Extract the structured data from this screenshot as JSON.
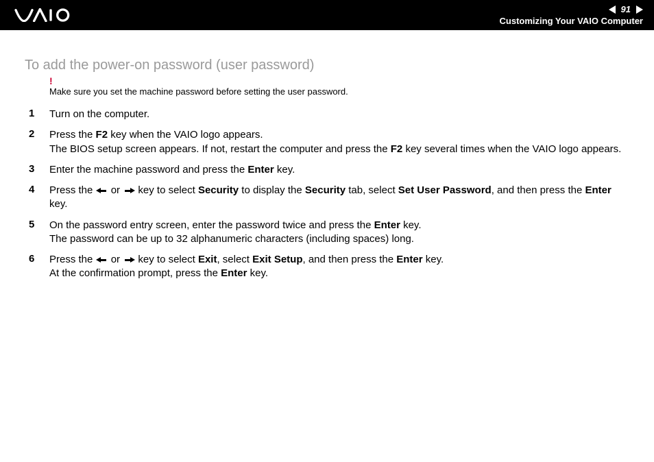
{
  "header": {
    "page_number": "91",
    "section_title": "Customizing Your VAIO Computer"
  },
  "heading": "To add the power-on password (user password)",
  "warning": {
    "icon": "!",
    "text": "Make sure you set the machine password before setting the user password."
  },
  "steps": [
    {
      "num": "1",
      "parts": [
        {
          "t": "text",
          "v": "Turn on the computer."
        }
      ]
    },
    {
      "num": "2",
      "parts": [
        {
          "t": "text",
          "v": "Press the "
        },
        {
          "t": "bold",
          "v": "F2"
        },
        {
          "t": "text",
          "v": " key when the VAIO logo appears."
        },
        {
          "t": "br"
        },
        {
          "t": "text",
          "v": "The BIOS setup screen appears. If not, restart the computer and press the "
        },
        {
          "t": "bold",
          "v": "F2"
        },
        {
          "t": "text",
          "v": " key several times when the VAIO logo appears."
        }
      ]
    },
    {
      "num": "3",
      "parts": [
        {
          "t": "text",
          "v": "Enter the machine password and press the "
        },
        {
          "t": "bold",
          "v": "Enter"
        },
        {
          "t": "text",
          "v": " key."
        }
      ]
    },
    {
      "num": "4",
      "parts": [
        {
          "t": "text",
          "v": "Press the "
        },
        {
          "t": "arrow-left"
        },
        {
          "t": "text",
          "v": " or "
        },
        {
          "t": "arrow-right"
        },
        {
          "t": "text",
          "v": " key to select "
        },
        {
          "t": "bold",
          "v": "Security"
        },
        {
          "t": "text",
          "v": " to display the "
        },
        {
          "t": "bold",
          "v": "Security"
        },
        {
          "t": "text",
          "v": " tab, select "
        },
        {
          "t": "bold",
          "v": "Set User Password"
        },
        {
          "t": "text",
          "v": ", and then press the "
        },
        {
          "t": "bold",
          "v": "Enter"
        },
        {
          "t": "text",
          "v": " key."
        }
      ]
    },
    {
      "num": "5",
      "parts": [
        {
          "t": "text",
          "v": "On the password entry screen, enter the password twice and press the "
        },
        {
          "t": "bold",
          "v": "Enter"
        },
        {
          "t": "text",
          "v": " key."
        },
        {
          "t": "br"
        },
        {
          "t": "text",
          "v": "The password can be up to 32 alphanumeric characters (including spaces) long."
        }
      ]
    },
    {
      "num": "6",
      "parts": [
        {
          "t": "text",
          "v": "Press the "
        },
        {
          "t": "arrow-left"
        },
        {
          "t": "text",
          "v": " or "
        },
        {
          "t": "arrow-right"
        },
        {
          "t": "text",
          "v": " key to select "
        },
        {
          "t": "bold",
          "v": "Exit"
        },
        {
          "t": "text",
          "v": ", select "
        },
        {
          "t": "bold",
          "v": "Exit Setup"
        },
        {
          "t": "text",
          "v": ", and then press the "
        },
        {
          "t": "bold",
          "v": "Enter"
        },
        {
          "t": "text",
          "v": " key."
        },
        {
          "t": "br"
        },
        {
          "t": "text",
          "v": "At the confirmation prompt, press the "
        },
        {
          "t": "bold",
          "v": "Enter"
        },
        {
          "t": "text",
          "v": " key."
        }
      ]
    }
  ]
}
